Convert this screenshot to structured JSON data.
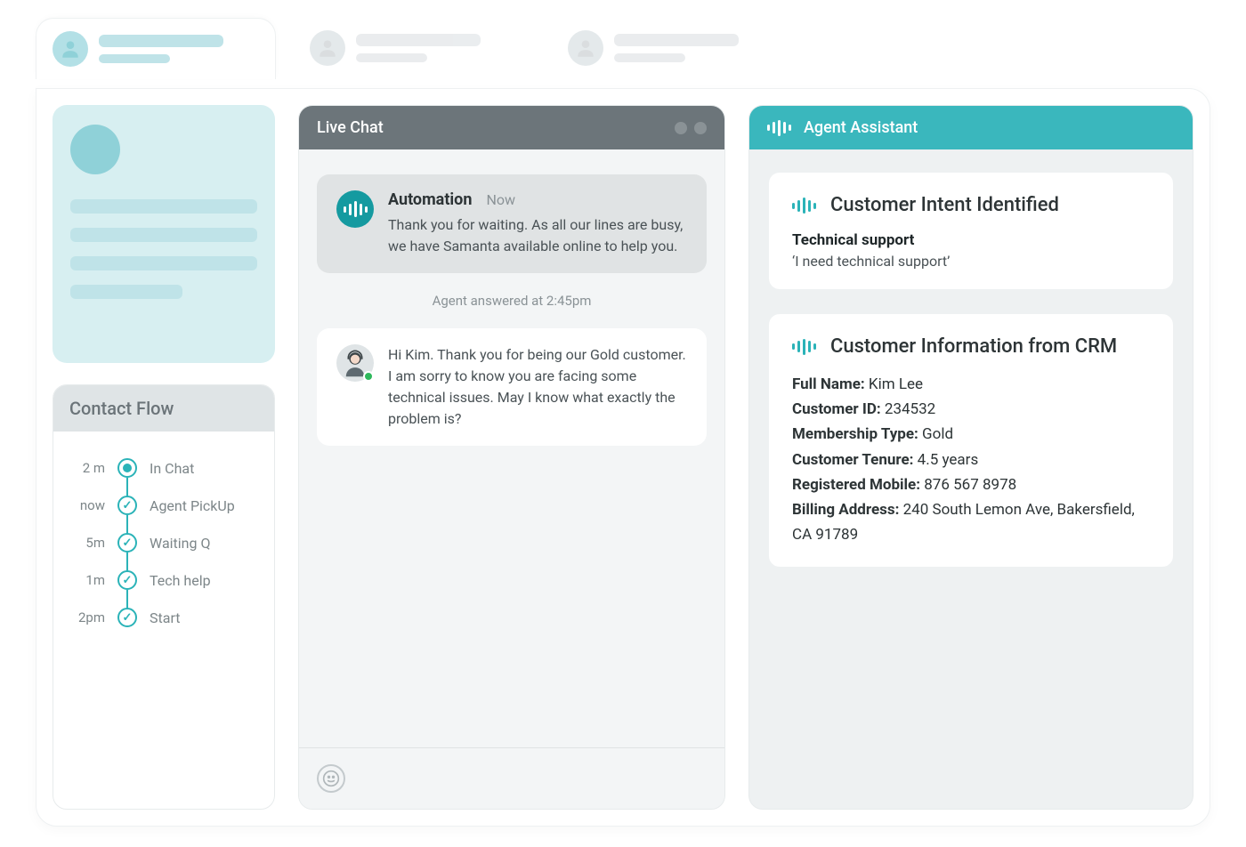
{
  "contactFlow": {
    "title": "Contact Flow",
    "items": [
      {
        "time": "2 m",
        "label": "In Chat",
        "state": "current"
      },
      {
        "time": "now",
        "label": "Agent PickUp",
        "state": "done"
      },
      {
        "time": "5m",
        "label": "Waiting Q",
        "state": "done"
      },
      {
        "time": "1m",
        "label": "Tech help",
        "state": "done"
      },
      {
        "time": "2pm",
        "label": "Start",
        "state": "done"
      }
    ]
  },
  "chat": {
    "title": "Live Chat",
    "automation": {
      "author": "Automation",
      "time": "Now",
      "text": "Thank you for waiting. As all our lines are busy, we have Samanta available online to help you."
    },
    "systemLine": "Agent answered at 2:45pm",
    "agentMsg": {
      "text": "Hi Kim. Thank you for being our Gold customer. I am sorry to know you are facing some technical issues. May I know what exactly the problem is?"
    }
  },
  "assistant": {
    "title": "Agent Assistant",
    "intentCard": {
      "title": "Customer Intent Identified",
      "subject": "Technical support",
      "quote": "‘I need technical support’"
    },
    "crmCard": {
      "title": "Customer Information from CRM",
      "fields": {
        "fullNameLabel": "Full Name:",
        "fullName": "Kim Lee",
        "customerIdLabel": "Customer ID:",
        "customerId": "234532",
        "membershipLabel": "Membership Type:",
        "membership": "Gold",
        "tenureLabel": "Customer Tenure:",
        "tenure": "4.5 years",
        "mobileLabel": "Registered Mobile:",
        "mobile": "876 567 8978",
        "billingLabel": "Billing Address:",
        "billing": "240 South Lemon Ave, Bakersfield, CA 91789"
      }
    }
  }
}
